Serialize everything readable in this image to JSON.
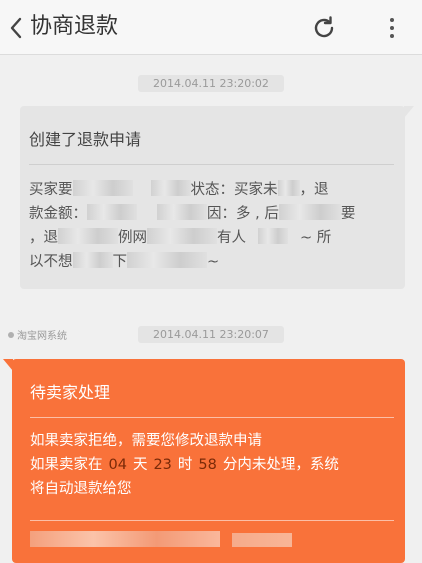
{
  "header": {
    "title": "协商退款",
    "back_icon": "chevron-left-icon",
    "refresh_icon": "refresh-icon",
    "more_icon": "more-vertical-icon"
  },
  "messages": [
    {
      "timestamp": "2014.04.11 23:20:02",
      "title": "创建了退款申请",
      "lines": [
        {
          "before": "买家要",
          "after": "状态：买家未",
          "end": "，退"
        },
        {
          "before": "款金额：",
          "after": "因：多 , 后",
          "end": "要"
        },
        {
          "before": "，退",
          "after": "例网",
          "end": "有人",
          "tail": "~ 所"
        },
        {
          "before": "以不想",
          "after": "下",
          "end": "~"
        }
      ]
    },
    {
      "sender": "淘宝网系统",
      "timestamp": "2014.04.11 23:20:07",
      "title": "待卖家处理",
      "line1": "如果卖家拒绝，需要您修改退款申请",
      "line2_prefix": "如果卖家在",
      "days": "04",
      "days_unit": "天",
      "hours": "23",
      "hours_unit": "时",
      "minutes": "58",
      "line2_suffix": "分内未处理，系统",
      "line3": "将自动退款给您"
    }
  ],
  "colors": {
    "accent": "#f9723a",
    "bubble_gray": "#e5e5e5",
    "background": "#f0f0f0"
  }
}
